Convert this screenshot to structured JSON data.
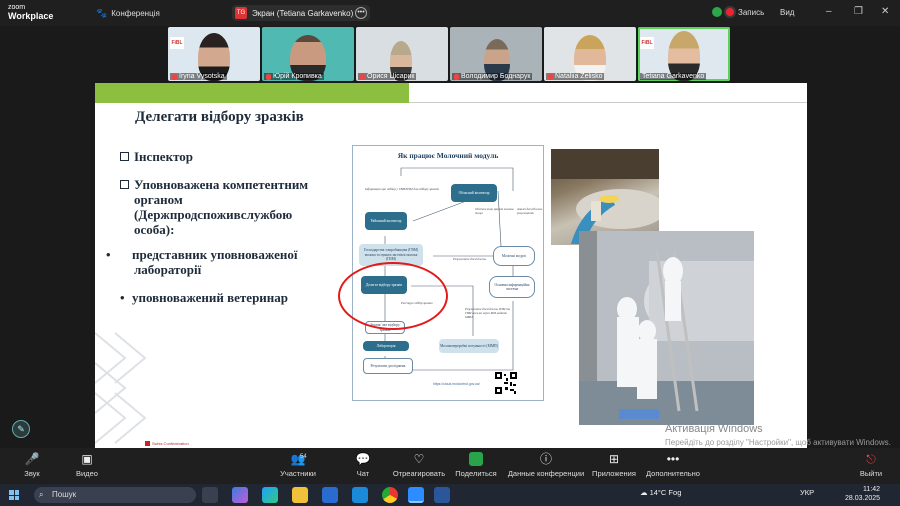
{
  "app": {
    "brand_top": "zoom",
    "brand_bottom": "Workplace",
    "conference_label": "Конференція",
    "share_label": "Экран (Tetiana Garkavenko)",
    "share_initials": "TG",
    "record_label": "Запись",
    "view_label": "Вид"
  },
  "participants": [
    {
      "name": "Iryna Vysotska",
      "muted": true
    },
    {
      "name": "Юрій Кропивка",
      "muted": true
    },
    {
      "name": "Орися Цісарик",
      "muted": true
    },
    {
      "name": "Володимир Боднарук",
      "muted": true
    },
    {
      "name": "Nataliia Zelisko",
      "muted": true
    },
    {
      "name": "Tetiana Garkavenko",
      "muted": false
    }
  ],
  "slide": {
    "title": "Делегати відбору зразків",
    "bullets": [
      {
        "style": "square",
        "text": "Інспектор"
      },
      {
        "style": "square",
        "text": "Уповноважена компетентним органом (Держпродспоживслужбою особа):"
      },
      {
        "style": "dot",
        "text": "представник уповноваженої лабораторії"
      },
      {
        "style": "dot",
        "text": "уповноважений ветеринар"
      }
    ],
    "footer": "Swiss Confederation"
  },
  "diagram": {
    "title": "Як працює Молочний модуль",
    "nodes": {
      "oblasnyi": "Обласний інспектор",
      "raionnyi": "Районний інспектор",
      "gospodarstvo": "Господарства з виробництва (ГВМ) молока та пункти заготівлі молока (ПЗМ)",
      "delegate": "Делегат відбору зразків",
      "akt": "Зразок/ акт відбору зразків",
      "laboratoriia": "Лабораторія",
      "rezultaty": "Результати досліджень",
      "molochnyi": "Молочні модулі",
      "osnovna": "Основна інформаційна система",
      "mmzh": "Молокопереробні потужності (ММП)"
    },
    "annotations": {
      "info": "Інформація про підбор у ГВМ/ПЗМ для відбору зразків",
      "obsv": "Обстеження зразків молока тощо",
      "rezsum": "Результати досліджень",
      "reg": "Реєструє відбір зразків",
      "rezult2": "Результати досліджень ПЗМ та ГВМ можна через ММ надати ММП",
      "ann_right": "Аналіз досліджень результатів"
    },
    "url": "https://cloud.molcontrol.gov.ua/"
  },
  "watermark": {
    "line1": "Активація Windows",
    "line2": "Перейдіть до розділу \"Настройки\", щоб активувати Windows."
  },
  "toolbar": {
    "mute": "Звук",
    "video": "Видео",
    "participants": "Участники",
    "participants_count": "54",
    "chat": "Чат",
    "react": "Отреагировать",
    "share": "Поделиться",
    "conf_data": "Данные конференции",
    "apps": "Приложения",
    "more": "Дополнительно",
    "leave": "Выйти"
  },
  "taskbar": {
    "search": "Пошук",
    "weather": "14°C Fog",
    "lang": "УКР",
    "time": "11:42",
    "date": "28.03.2025"
  }
}
